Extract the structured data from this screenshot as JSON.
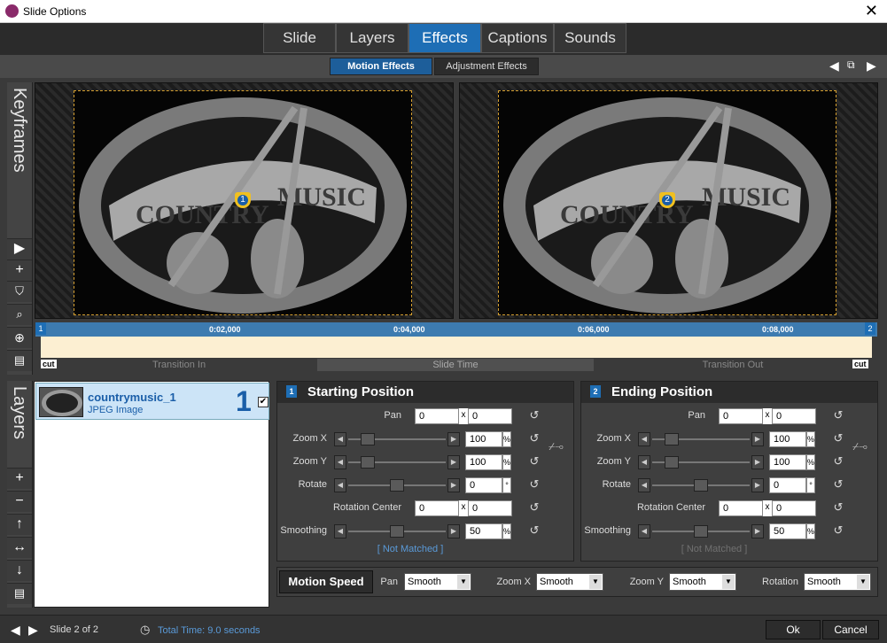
{
  "window": {
    "title": "Slide Options",
    "close_icon": "close-icon"
  },
  "tabs": [
    {
      "label": "Slide"
    },
    {
      "label": "Layers"
    },
    {
      "label": "Effects"
    },
    {
      "label": "Captions"
    },
    {
      "label": "Sounds"
    }
  ],
  "subtabs": {
    "motion": "Motion Effects",
    "adjustment": "Adjustment Effects"
  },
  "keyframes_label": "Keyframes",
  "layers_label": "Layers",
  "preview": {
    "start_keyframe": "1",
    "end_keyframe": "2",
    "image_text_left": "COUNTRY",
    "image_text_right": "MUSIC"
  },
  "timeline": {
    "ticks": [
      "0:02,000",
      "0:04,000",
      "0:06,000",
      "0:08,000"
    ],
    "start_flag": "1",
    "end_flag": "2",
    "cut": "cut",
    "segments": {
      "in": "Transition In",
      "slide": "Slide Time",
      "out": "Transition Out"
    }
  },
  "layer": {
    "name": "countrymusic_1",
    "type": "JPEG Image",
    "number": "1",
    "checked": true
  },
  "start": {
    "title": "Starting Position",
    "badge": "1",
    "pan_label": "Pan",
    "pan_x": "0",
    "pan_y": "0",
    "x": "x",
    "zoomx_label": "Zoom X",
    "zoomx": "100",
    "zoomy_label": "Zoom Y",
    "zoomy": "100",
    "rotate_label": "Rotate",
    "rotate": "0",
    "rc_label": "Rotation Center",
    "rc_x": "0",
    "rc_y": "0",
    "smooth_label": "Smoothing",
    "smooth": "50",
    "pct": "%",
    "deg": "°",
    "not_matched": "[ Not Matched ]"
  },
  "end": {
    "title": "Ending Position",
    "badge": "2",
    "pan_label": "Pan",
    "pan_x": "0",
    "pan_y": "0",
    "x": "x",
    "zoomx_label": "Zoom X",
    "zoomx": "100",
    "zoomy_label": "Zoom Y",
    "zoomy": "100",
    "rotate_label": "Rotate",
    "rotate": "0",
    "rc_label": "Rotation Center",
    "rc_x": "0",
    "rc_y": "0",
    "smooth_label": "Smoothing",
    "smooth": "50",
    "pct": "%",
    "deg": "°",
    "not_matched": "[ Not Matched ]"
  },
  "motion_speed": {
    "button": "Motion Speed",
    "pan_label": "Pan",
    "pan": "Smooth",
    "zoomx_label": "Zoom X",
    "zoomx": "Smooth",
    "zoomy_label": "Zoom Y",
    "zoomy": "Smooth",
    "rotation_label": "Rotation",
    "rotation": "Smooth"
  },
  "footer": {
    "slide_info": "Slide 2 of 2",
    "total_time": "Total Time: 9.0 seconds",
    "ok": "Ok",
    "cancel": "Cancel"
  },
  "colors": {
    "accent": "#1e6eb5",
    "marker": "#f0c020",
    "timeline_bg": "#fcefd2"
  }
}
